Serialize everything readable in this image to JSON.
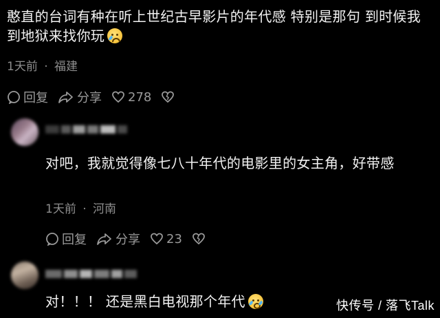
{
  "comment1": {
    "text": "憨直的台词有种在听上世纪古早影片的年代感 特别是那句 到时候我到地狱来找你玩",
    "emoji": "crying-face-emoji",
    "time": "1天前",
    "location": "福建",
    "reply_label": "回复",
    "share_label": "分享",
    "like_count": "278"
  },
  "comment2": {
    "text": "对吧，我就觉得像七八十年代的电影里的女主角，好带感",
    "time": "1天前",
    "location": "河南",
    "reply_label": "回复",
    "share_label": "分享",
    "like_count": "23"
  },
  "comment3": {
    "text": "对！！！ 还是黑白电视那个年代",
    "emoji": "sobbing-face-emoji"
  },
  "meta_separator": "·",
  "watermark": {
    "text": "快传号 / 落飞Talk"
  },
  "colors": {
    "background": "#000000",
    "text": "#f2f2f2",
    "meta": "#8e8e8e"
  }
}
